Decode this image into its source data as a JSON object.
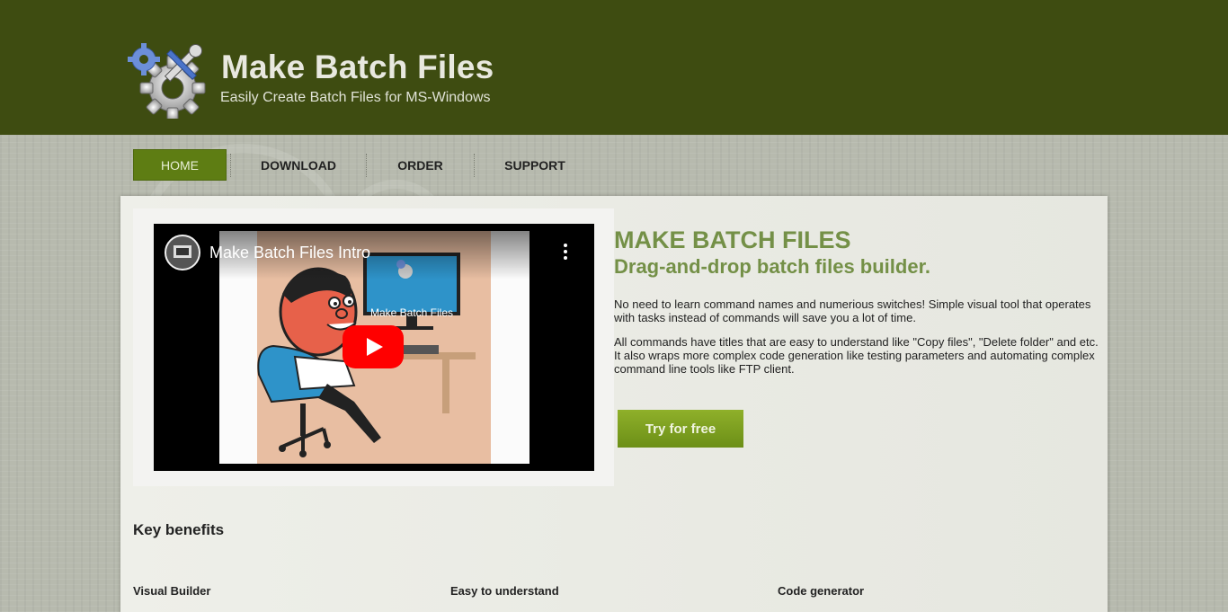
{
  "header": {
    "title": "Make Batch Files",
    "tagline": "Easily Create Batch Files for MS-Windows",
    "logo_icon": "gears-wrench-icon"
  },
  "nav": {
    "items": [
      {
        "label": "HOME",
        "active": true
      },
      {
        "label": "DOWNLOAD",
        "active": false
      },
      {
        "label": "ORDER",
        "active": false
      },
      {
        "label": "SUPPORT",
        "active": false
      }
    ]
  },
  "video": {
    "title": "Make Batch Files Intro",
    "screen_label": "Make Batch Files",
    "play_icon": "youtube-play-icon",
    "menu_icon": "more-vertical-icon"
  },
  "hero": {
    "headline": "MAKE BATCH FILES",
    "subheadline": "Drag-and-drop batch files builder.",
    "paragraph1": "No need to learn command names and numerious switches! Simple visual tool that operates with tasks instead of commands will save you a lot of time.",
    "paragraph2": "All commands have titles that are easy to understand like \"Copy files\", \"Delete folder\" and etc. It also wraps more complex code generation like testing parameters and automating complex command line tools like FTP client.",
    "cta_label": "Try for free"
  },
  "benefits": {
    "title": "Key benefits",
    "items": [
      "Visual Builder",
      "Easy to understand",
      "Code generator"
    ]
  },
  "colors": {
    "header_bg": "#3e4c11",
    "nav_active": "#5e7d13",
    "accent_text": "#749047",
    "cta": "#7a9e1f",
    "youtube_red": "#ff0000"
  }
}
